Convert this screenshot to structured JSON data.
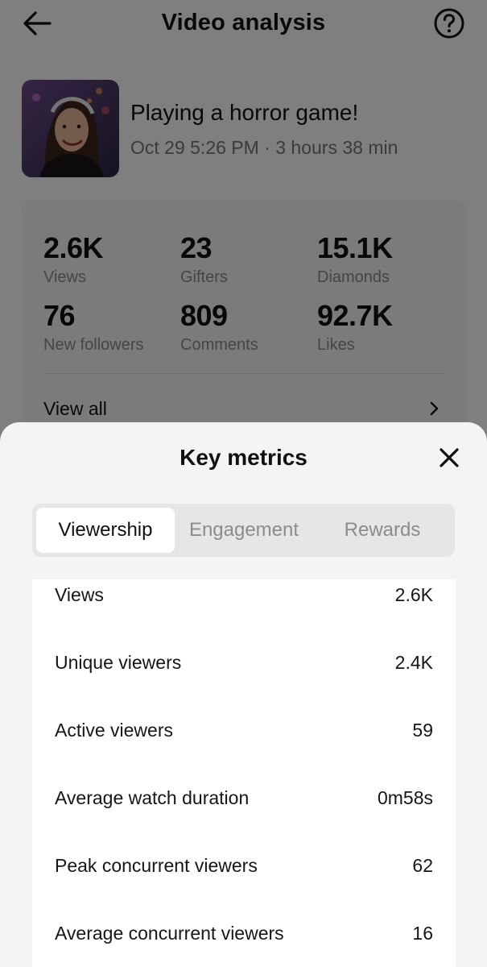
{
  "header": {
    "title": "Video analysis",
    "back_icon": "arrow-left-icon",
    "help_icon": "help-circle-icon"
  },
  "video": {
    "title": "Playing a horror game!",
    "meta": "Oct 29 5:26 PM · 3 hours 38 min"
  },
  "stats": [
    {
      "value": "2.6K",
      "label": "Views"
    },
    {
      "value": "23",
      "label": "Gifters"
    },
    {
      "value": "15.1K",
      "label": "Diamonds"
    },
    {
      "value": "76",
      "label": "New followers"
    },
    {
      "value": "809",
      "label": "Comments"
    },
    {
      "value": "92.7K",
      "label": "Likes"
    }
  ],
  "view_all": {
    "label": "View all"
  },
  "sheet": {
    "title": "Key metrics",
    "close_icon": "close-icon",
    "tabs": [
      {
        "label": "Viewership",
        "active": true
      },
      {
        "label": "Engagement",
        "active": false
      },
      {
        "label": "Rewards",
        "active": false
      }
    ],
    "metrics": [
      {
        "label": "Views",
        "value": "2.6K"
      },
      {
        "label": "Unique viewers",
        "value": "2.4K"
      },
      {
        "label": "Active viewers",
        "value": "59"
      },
      {
        "label": "Average watch duration",
        "value": "0m58s"
      },
      {
        "label": "Peak concurrent viewers",
        "value": "62"
      },
      {
        "label": "Average concurrent viewers",
        "value": "16"
      }
    ]
  }
}
